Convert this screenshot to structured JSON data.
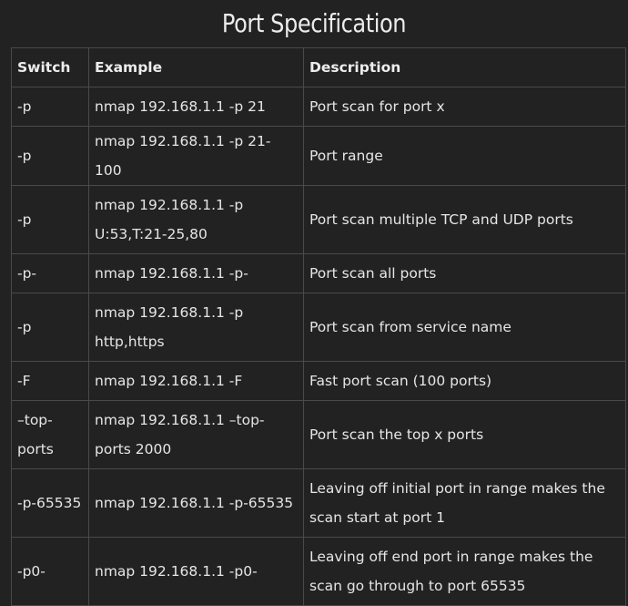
{
  "page": {
    "title": "Port Specification"
  },
  "table": {
    "columns": [
      "Switch",
      "Example",
      "Description"
    ],
    "rows": [
      {
        "switch": "-p",
        "example": "nmap 192.168.1.1 -p 21",
        "description": "Port scan for port x"
      },
      {
        "switch": "-p",
        "example": "nmap 192.168.1.1 -p 21-100",
        "description": "Port range"
      },
      {
        "switch": "-p",
        "example": "nmap 192.168.1.1 -p U:53,T:21-25,80",
        "description": "Port scan multiple TCP and UDP ports"
      },
      {
        "switch": "-p-",
        "example": "nmap 192.168.1.1 -p-",
        "description": "Port scan all ports"
      },
      {
        "switch": "-p",
        "example": "nmap 192.168.1.1 -p http,https",
        "description": "Port scan from service name"
      },
      {
        "switch": "-F",
        "example": "nmap 192.168.1.1 -F",
        "description": "Fast port scan (100 ports)"
      },
      {
        "switch": "–top-ports",
        "example": "nmap 192.168.1.1 –top-ports 2000",
        "description": "Port scan the top x ports"
      },
      {
        "switch": "-p-65535",
        "example": "nmap 192.168.1.1 -p-65535",
        "description": "Leaving off initial port in range makes the scan start at port 1"
      },
      {
        "switch": "-p0-",
        "example": "nmap 192.168.1.1 -p0-",
        "description": "Leaving off end port in range makes the scan go through to port 65535"
      }
    ]
  },
  "colors": {
    "background": "#222222",
    "border": "#4a4a4a",
    "text": "#e6e6e6"
  }
}
